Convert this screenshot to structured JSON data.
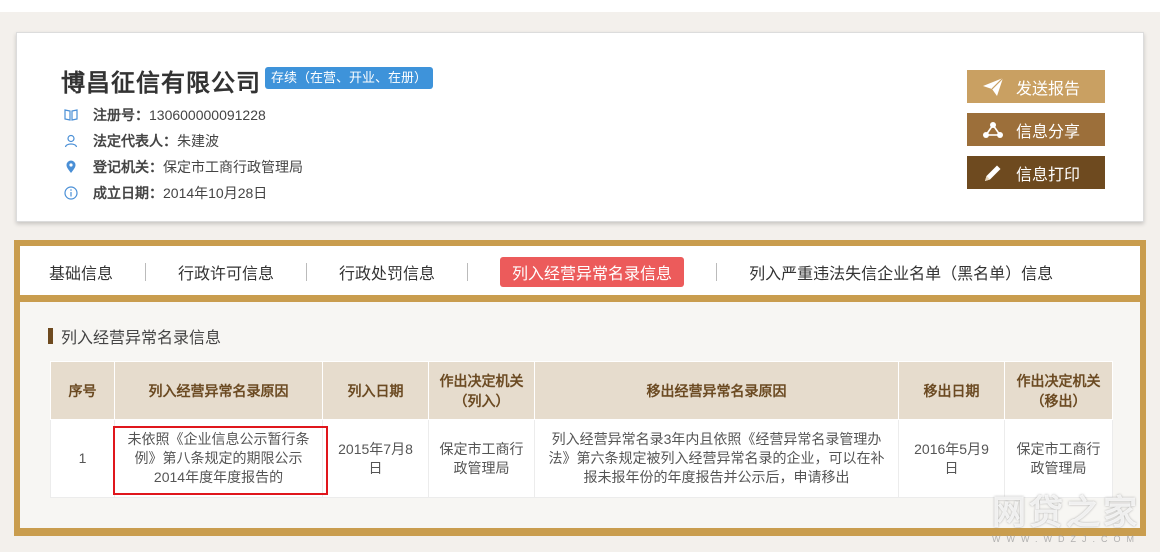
{
  "company": {
    "name": "博昌征信有限公司",
    "status": "存续（在营、开业、在册）",
    "reg_label": "注册号：",
    "reg_value": "130600000091228",
    "rep_label": "法定代表人：",
    "rep_value": "朱建波",
    "authority_label": "登记机关：",
    "authority_value": "保定市工商行政管理局",
    "date_label": "成立日期：",
    "date_value": "2014年10月28日"
  },
  "actions": {
    "send": "发送报告",
    "share": "信息分享",
    "print": "信息打印"
  },
  "tabs": [
    "基础信息",
    "行政许可信息",
    "行政处罚信息",
    "列入经营异常名录信息",
    "列入严重违法失信企业名单（黑名单）信息"
  ],
  "active_tab": 3,
  "section": {
    "title": "列入经营异常名录信息"
  },
  "table": {
    "headers": [
      "序号",
      "列入经营异常名录原因",
      "列入日期",
      "作出决定机关（列入）",
      "移出经营异常名录原因",
      "移出日期",
      "作出决定机关（移出）"
    ],
    "rows": [
      [
        "1",
        "未依照《企业信息公示暂行条例》第八条规定的期限公示2014年度年度报告的",
        "2015年7月8日",
        "保定市工商行政管理局",
        "列入经营异常名录3年内且依照《经营异常名录管理办法》第六条规定被列入经营异常名录的企业，可以在补报未报年份的年度报告并公示后，申请移出",
        "2016年5月9日",
        "保定市工商行政管理局"
      ]
    ]
  },
  "watermark": {
    "cn": "网贷之家",
    "en": "WWW.WDZJ.COM"
  },
  "colors": {
    "badge": "#3e93da",
    "send_btn": "#c9a062",
    "share_btn": "#9c6f3a",
    "print_btn": "#6e4a1f",
    "panel_border": "#c99d4e",
    "active_tab": "#ec5b5b",
    "highlight_box": "#e0161c"
  }
}
